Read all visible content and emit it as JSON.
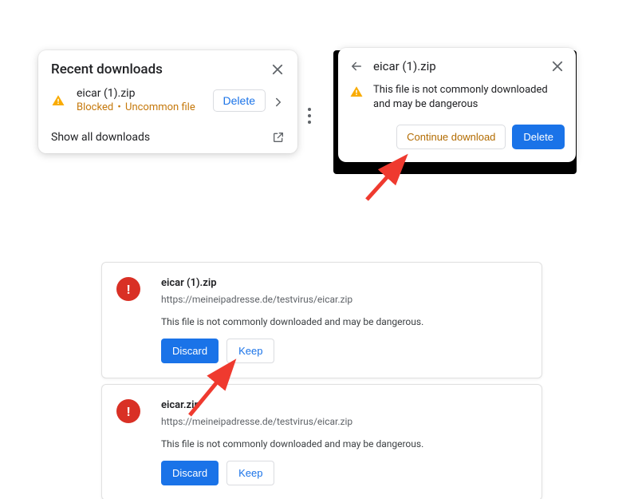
{
  "panel1": {
    "title": "Recent downloads",
    "file_name": "eicar (1).zip",
    "status_blocked": "Blocked",
    "status_reason": "Uncommon file",
    "delete_label": "Delete",
    "show_all": "Show all downloads"
  },
  "panel2": {
    "title": "eicar (1).zip",
    "message": "This file is not commonly downloaded and may be dangerous",
    "continue_label": "Continue download",
    "delete_label": "Delete"
  },
  "card3": {
    "file_name": "eicar (1).zip",
    "url": "https://meineipadresse.de/testvirus/eicar.zip",
    "warning": "This file is not commonly downloaded and may be dangerous.",
    "discard": "Discard",
    "keep": "Keep"
  },
  "card4": {
    "file_name": "eicar.zip",
    "url": "https://meineipadresse.de/testvirus/eicar.zip",
    "warning": "This file is not commonly downloaded and may be dangerous.",
    "discard": "Discard",
    "keep": "Keep"
  },
  "colors": {
    "primary_blue": "#1a73e8",
    "amber": "#b26b00",
    "danger_red": "#d93025",
    "arrow_red": "#ef3a2f"
  }
}
